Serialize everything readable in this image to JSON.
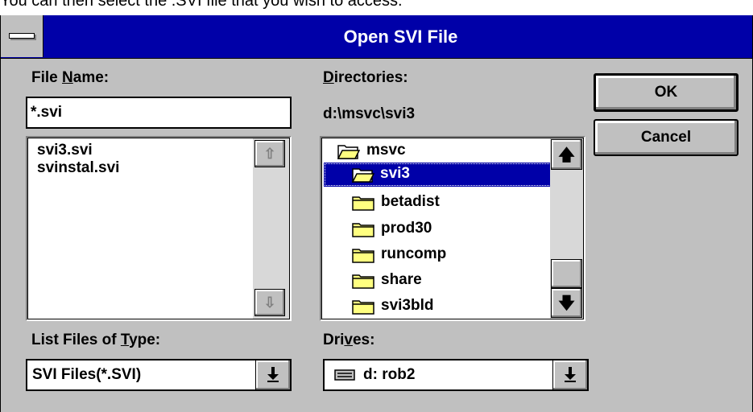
{
  "caption_text": "You can then select the .SVI file that you wish to access.",
  "window": {
    "title": "Open SVI File"
  },
  "file_name": {
    "label_pre": "File ",
    "label_u": "N",
    "label_post": "ame:",
    "value": "*.svi"
  },
  "files": [
    "svi3.svi",
    "svinstal.svi"
  ],
  "directories": {
    "label_u": "D",
    "label_post": "irectories:",
    "current_path": "d:\\msvc\\svi3",
    "items": [
      {
        "name": "msvc",
        "icon": "open-folder-icon",
        "selected": false
      },
      {
        "name": "svi3",
        "icon": "open-folder-icon",
        "selected": true
      },
      {
        "name": "betadist",
        "icon": "folder-icon",
        "selected": false
      },
      {
        "name": "prod30",
        "icon": "folder-icon",
        "selected": false
      },
      {
        "name": "runcomp",
        "icon": "folder-icon",
        "selected": false
      },
      {
        "name": "share",
        "icon": "folder-icon",
        "selected": false
      },
      {
        "name": "svi3bld",
        "icon": "folder-icon",
        "selected": false
      }
    ]
  },
  "file_type": {
    "label_pre": "List Files of ",
    "label_u": "T",
    "label_post": "ype:",
    "value": "SVI Files(*.SVI)"
  },
  "drives": {
    "label_pre": "Dri",
    "label_u": "v",
    "label_post": "es:",
    "value": "d: rob2",
    "icon": "drive-icon"
  },
  "buttons": {
    "ok": "OK",
    "cancel": "Cancel"
  },
  "colors": {
    "titlebar": "#0000a8",
    "face": "#c0c0c0",
    "selection": "#0000a8"
  }
}
